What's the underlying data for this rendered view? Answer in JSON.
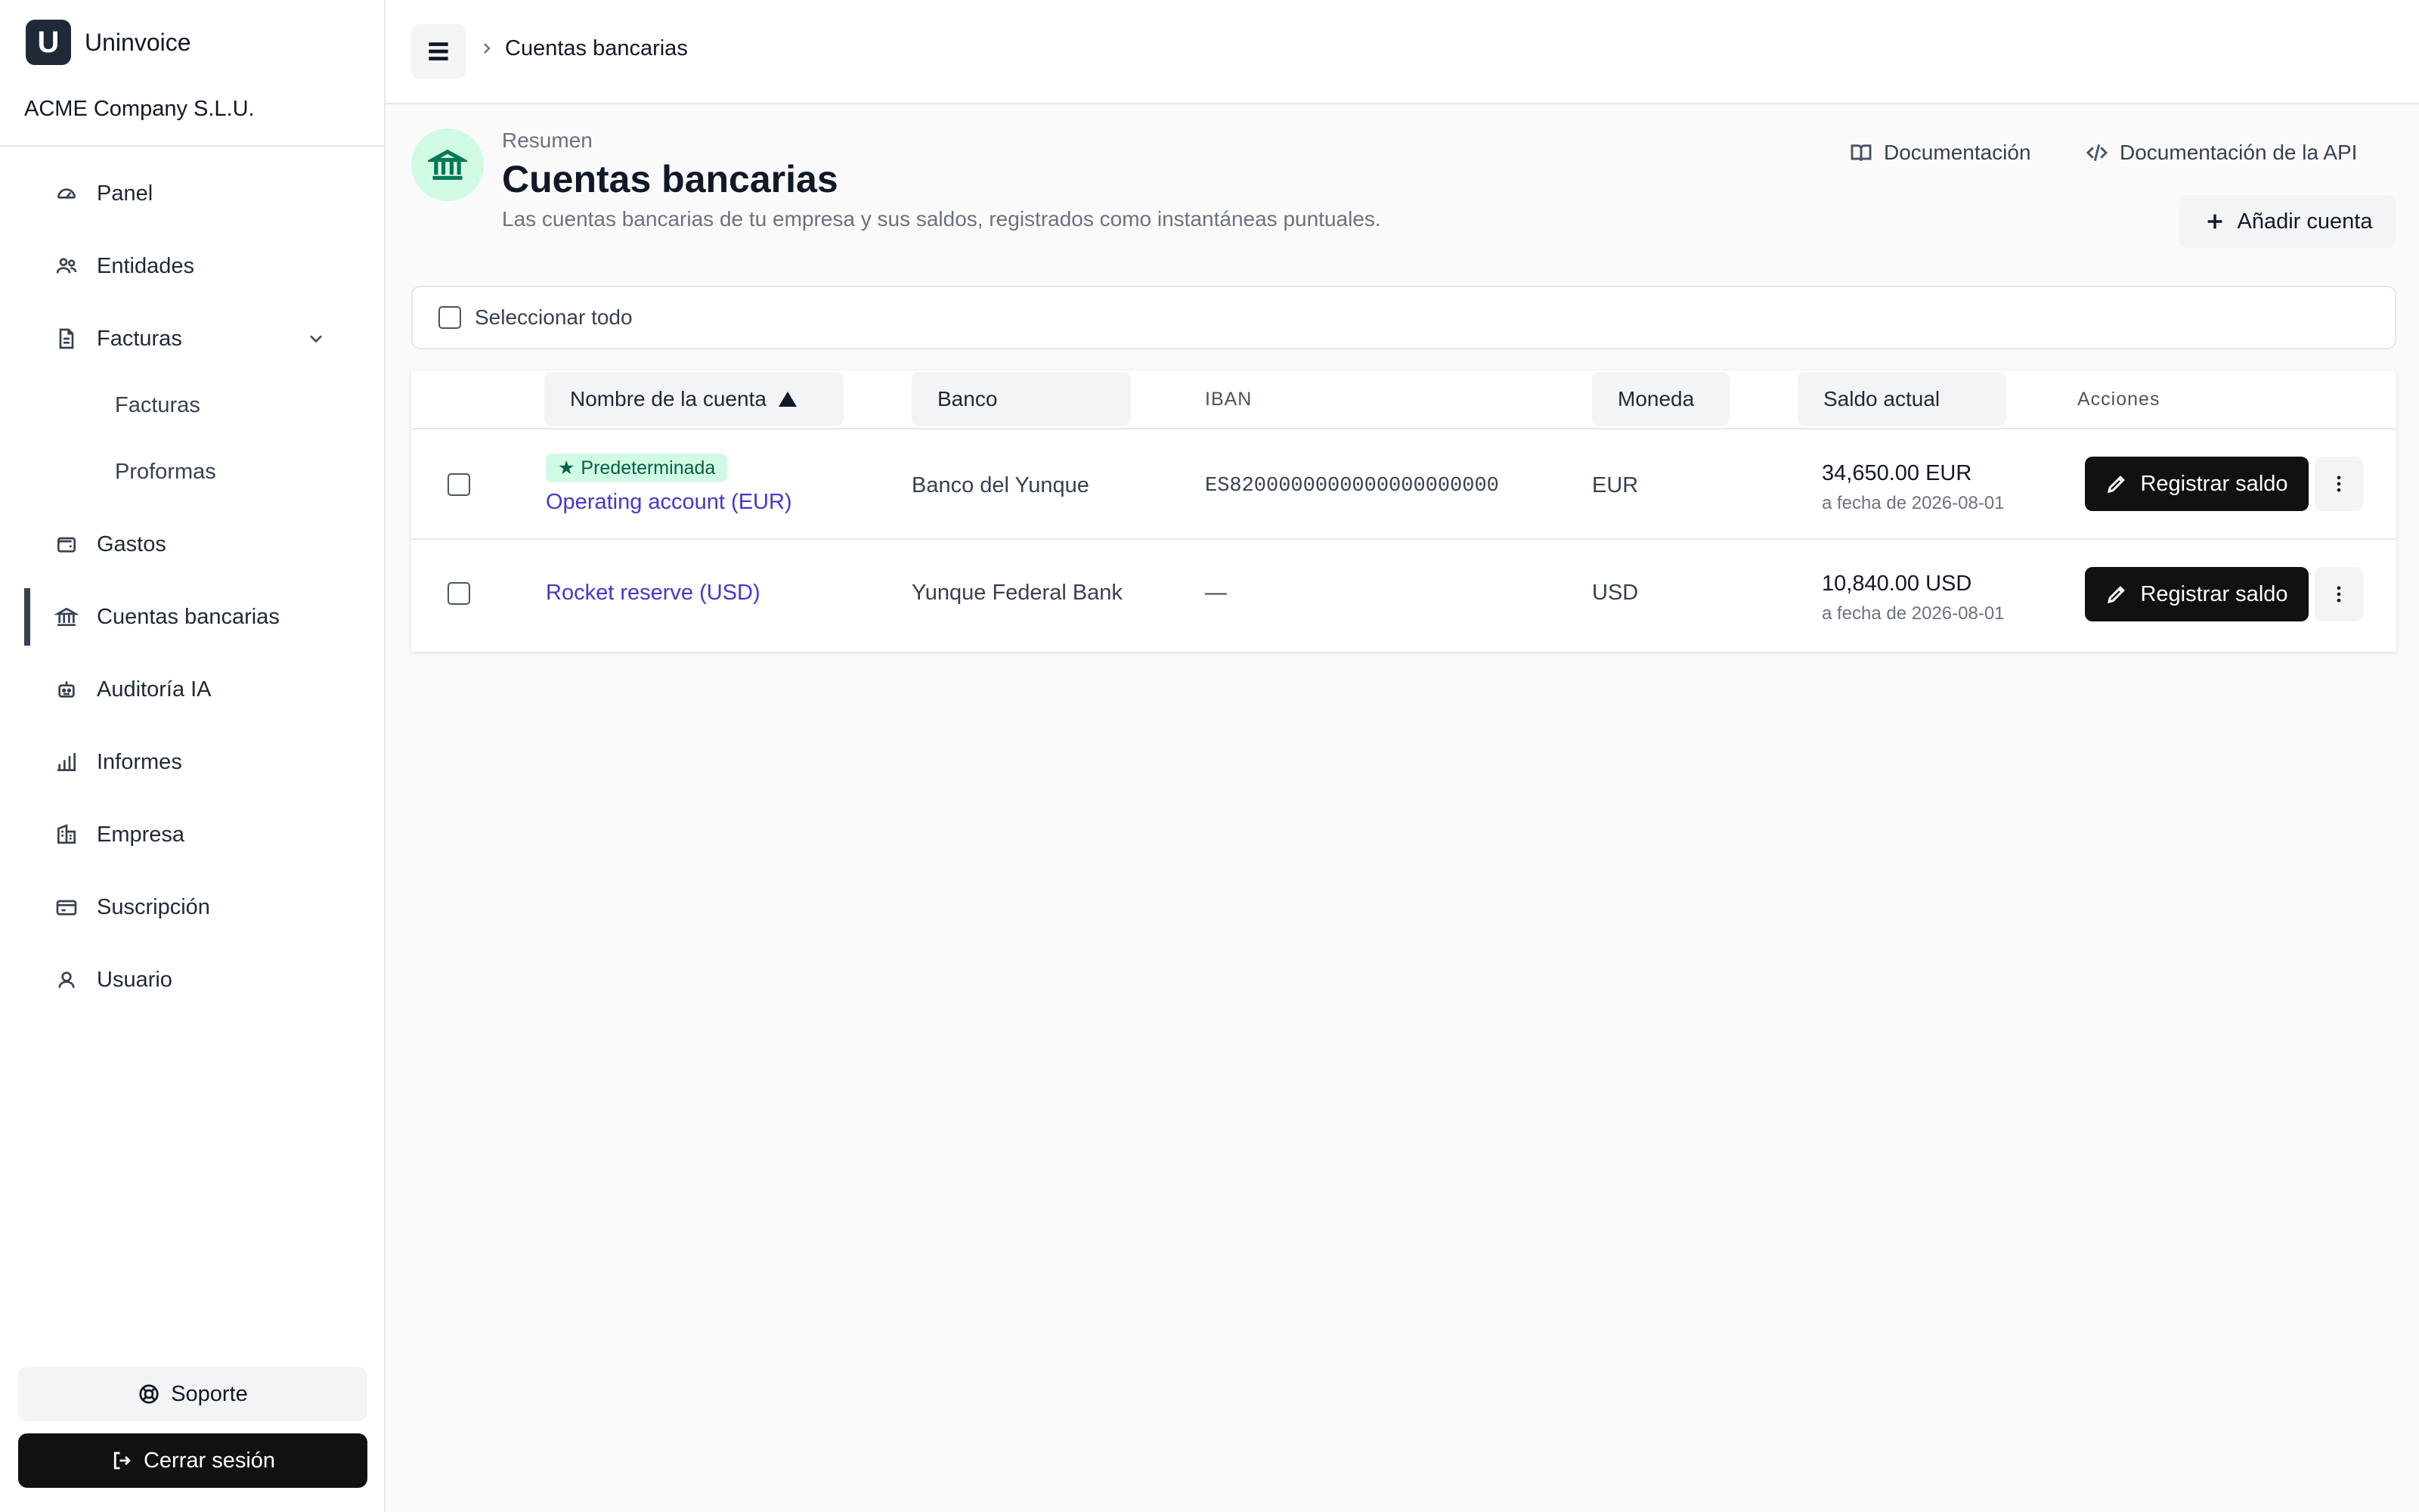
{
  "brand": {
    "logo_letter": "U",
    "name": "Uninvoice"
  },
  "company": "ACME Company S.L.U.",
  "sidebar": {
    "items": [
      {
        "label": "Panel",
        "icon": "gauge-icon"
      },
      {
        "label": "Entidades",
        "icon": "users-icon"
      },
      {
        "label": "Facturas",
        "icon": "file-icon"
      },
      {
        "label": "Gastos",
        "icon": "wallet-icon"
      },
      {
        "label": "Cuentas bancarias",
        "icon": "bank-icon"
      },
      {
        "label": "Auditoría IA",
        "icon": "bot-icon"
      },
      {
        "label": "Informes",
        "icon": "bar-chart-icon"
      },
      {
        "label": "Empresa",
        "icon": "building-icon"
      },
      {
        "label": "Suscripción",
        "icon": "credit-card-icon"
      },
      {
        "label": "Usuario",
        "icon": "user-icon"
      }
    ],
    "subitems": [
      "Facturas",
      "Proformas"
    ],
    "support_label": "Soporte",
    "logout_label": "Cerrar sesión"
  },
  "topbar": {
    "breadcrumb": "Cuentas bancarias"
  },
  "header": {
    "eyebrow": "Resumen",
    "title": "Cuentas bancarias",
    "description": "Las cuentas bancarias de tu empresa y sus saldos, registrados como instantáneas puntuales.",
    "docs_label": "Documentación",
    "api_docs_label": "Documentación de la API",
    "add_label": "Añadir cuenta"
  },
  "select_all_label": "Seleccionar todo",
  "table": {
    "columns": [
      "Nombre de la cuenta",
      "Banco",
      "IBAN",
      "Moneda",
      "Saldo actual",
      "Acciones"
    ],
    "rows": [
      {
        "badge": "Predeterminada",
        "name": "Operating account (EUR)",
        "bank": "Banco del Yunque",
        "iban": "ES8200000000000000000000",
        "currency": "EUR",
        "balance": "34,650.00 EUR",
        "balance_date": "a fecha de 2026-08-01",
        "action_label": "Registrar saldo"
      },
      {
        "name": "Rocket reserve (USD)",
        "bank": "Yunque Federal Bank",
        "iban": "—",
        "currency": "USD",
        "balance": "10,840.00 USD",
        "balance_date": "a fecha de 2026-08-01",
        "action_label": "Registrar saldo"
      }
    ]
  },
  "colors": {
    "accent_link": "#4338ca",
    "badge_bg": "#d1fae5",
    "badge_text": "#065f46",
    "primary_button": "#111111"
  }
}
